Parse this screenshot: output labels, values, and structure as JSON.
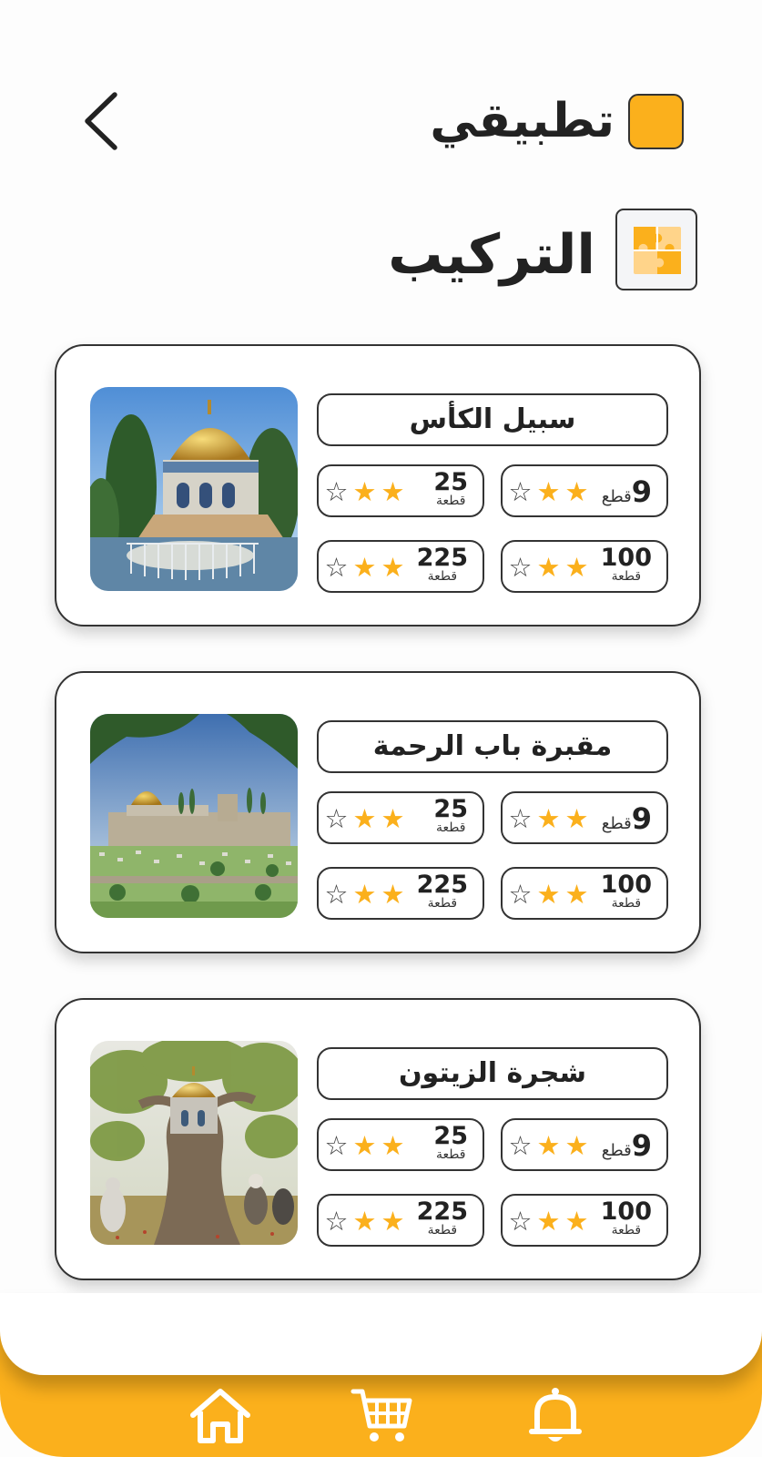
{
  "app": {
    "title": "تطبيقي",
    "logo_color": "#fbb01c",
    "back_icon": "chevron-left-icon"
  },
  "section": {
    "title": "التركيب",
    "icon": "puzzle-icon"
  },
  "accent_color": "#fbb01c",
  "puzzles": [
    {
      "title": "سبيل الكأس",
      "image": "dome-of-the-rock-fountain-painting",
      "options": [
        {
          "count": "9",
          "unit": "قطع",
          "stars_earned": 2,
          "stars_total": 3
        },
        {
          "count": "25",
          "unit": "قطعة",
          "stars_earned": 2,
          "stars_total": 3
        },
        {
          "count": "100",
          "unit": "قطعة",
          "stars_earned": 2,
          "stars_total": 3
        },
        {
          "count": "225",
          "unit": "قطعة",
          "stars_earned": 2,
          "stars_total": 3
        }
      ]
    },
    {
      "title": "مقبرة باب الرحمة",
      "image": "bab-al-rahma-cemetery-painting",
      "options": [
        {
          "count": "9",
          "unit": "قطع",
          "stars_earned": 2,
          "stars_total": 3
        },
        {
          "count": "25",
          "unit": "قطعة",
          "stars_earned": 2,
          "stars_total": 3
        },
        {
          "count": "100",
          "unit": "قطعة",
          "stars_earned": 2,
          "stars_total": 3
        },
        {
          "count": "225",
          "unit": "قطعة",
          "stars_earned": 2,
          "stars_total": 3
        }
      ]
    },
    {
      "title": "شجرة الزيتون",
      "image": "olive-tree-dome-painting",
      "options": [
        {
          "count": "9",
          "unit": "قطع",
          "stars_earned": 2,
          "stars_total": 3
        },
        {
          "count": "25",
          "unit": "قطعة",
          "stars_earned": 2,
          "stars_total": 3
        },
        {
          "count": "100",
          "unit": "قطعة",
          "stars_earned": 2,
          "stars_total": 3
        },
        {
          "count": "225",
          "unit": "قطعة",
          "stars_earned": 2,
          "stars_total": 3
        }
      ]
    }
  ],
  "bottom_nav": [
    {
      "icon": "home-icon"
    },
    {
      "icon": "cart-icon"
    },
    {
      "icon": "bell-icon"
    }
  ]
}
